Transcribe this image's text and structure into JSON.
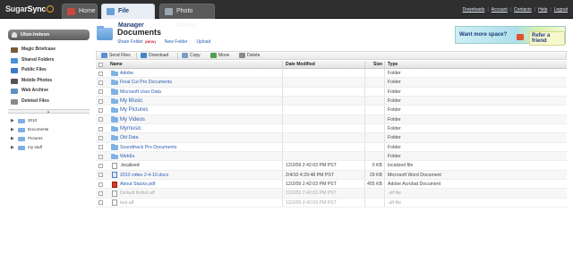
{
  "app": {
    "logo_text_a": "Sugar",
    "logo_text_b": "Sync"
  },
  "tabs": [
    {
      "label": "Home",
      "active": false
    },
    {
      "label": "File Manager",
      "active": true
    },
    {
      "label": "Photo Gallery",
      "active": false
    }
  ],
  "top_links": [
    "Downloads",
    "Account",
    "Contacts",
    "Help",
    "Logout"
  ],
  "sidebar": {
    "user_label": "Ulon-Ireleon",
    "items": [
      {
        "label": "Magic Briefcase",
        "icon": "briefcase-icon"
      },
      {
        "label": "Shared Folders",
        "icon": "shared-folder-icon"
      },
      {
        "label": "Public Files",
        "icon": "public-files-icon"
      },
      {
        "label": "Mobile Photos",
        "icon": "mobile-photos-icon"
      },
      {
        "label": "Web Archive",
        "icon": "web-archive-icon"
      },
      {
        "label": "Deleted Files",
        "icon": "trash-icon"
      }
    ],
    "tree": [
      {
        "label": "2010"
      },
      {
        "label": "Documents"
      },
      {
        "label": "Pictures"
      },
      {
        "label": "my stuff"
      }
    ]
  },
  "main": {
    "title": "Documents",
    "actions": {
      "share_folder": "Share Folder",
      "new_badge": "(NEW)",
      "new_folder": "New Folder",
      "upload": "Upload"
    },
    "promo": {
      "text_left": "Want more space?",
      "text_right": "Refer a friend"
    },
    "toolbar": {
      "send_files": "Send Files",
      "download": "Download",
      "copy": "Copy",
      "move": "Move",
      "delete": "Delete"
    },
    "columns": {
      "name": "Name",
      "date": "Date Modified",
      "size": "Size",
      "type": "Type"
    },
    "rows": [
      {
        "name": "Adobe",
        "date": "",
        "size": "",
        "type": "Folder",
        "kind": "folder"
      },
      {
        "name": "Final Cut Pro Documents",
        "date": "",
        "size": "",
        "type": "Folder",
        "kind": "folder"
      },
      {
        "name": "Microsoft User Data",
        "date": "",
        "size": "",
        "type": "Folder",
        "kind": "folder"
      },
      {
        "name": "My Music",
        "date": "",
        "size": "",
        "type": "Folder",
        "kind": "folder"
      },
      {
        "name": "My Pictures",
        "date": "",
        "size": "",
        "type": "Folder",
        "kind": "folder"
      },
      {
        "name": "My Videos",
        "date": "",
        "size": "",
        "type": "Folder",
        "kind": "folder"
      },
      {
        "name": "Mymusic",
        "date": "",
        "size": "",
        "type": "Folder",
        "kind": "folder"
      },
      {
        "name": "Old Data",
        "date": "",
        "size": "",
        "type": "Folder",
        "kind": "folder"
      },
      {
        "name": "Soundtrack Pro Documents",
        "date": "",
        "size": "",
        "type": "Folder",
        "kind": "folder"
      },
      {
        "name": "WebEx",
        "date": "",
        "size": "",
        "type": "Folder",
        "kind": "folder"
      },
      {
        "name": ".localized",
        "date": "12/2/09 2:42:03 PM PST",
        "size": "0 KB",
        "type": "localized file",
        "kind": "doc"
      },
      {
        "name": "2010 video 2-4-10.docx",
        "date": "2/4/10 4:29:48 PM PST",
        "size": "29 KB",
        "type": "Microsoft Word Document",
        "kind": "word"
      },
      {
        "name": "About Stacks.pdf",
        "date": "12/2/09 2:42:03 PM PST",
        "size": "455 KB",
        "type": "Adobe Acrobat Document",
        "kind": "pdf"
      },
      {
        "name": "Default Robot.alf",
        "date": "12/2/09 2:42:03 PM PST",
        "size": "",
        "type": ".alf file",
        "kind": "faded"
      },
      {
        "name": "test.alf",
        "date": "12/2/09 2:42:03 PM PST",
        "size": "",
        "type": ".alf file",
        "kind": "faded"
      }
    ]
  }
}
